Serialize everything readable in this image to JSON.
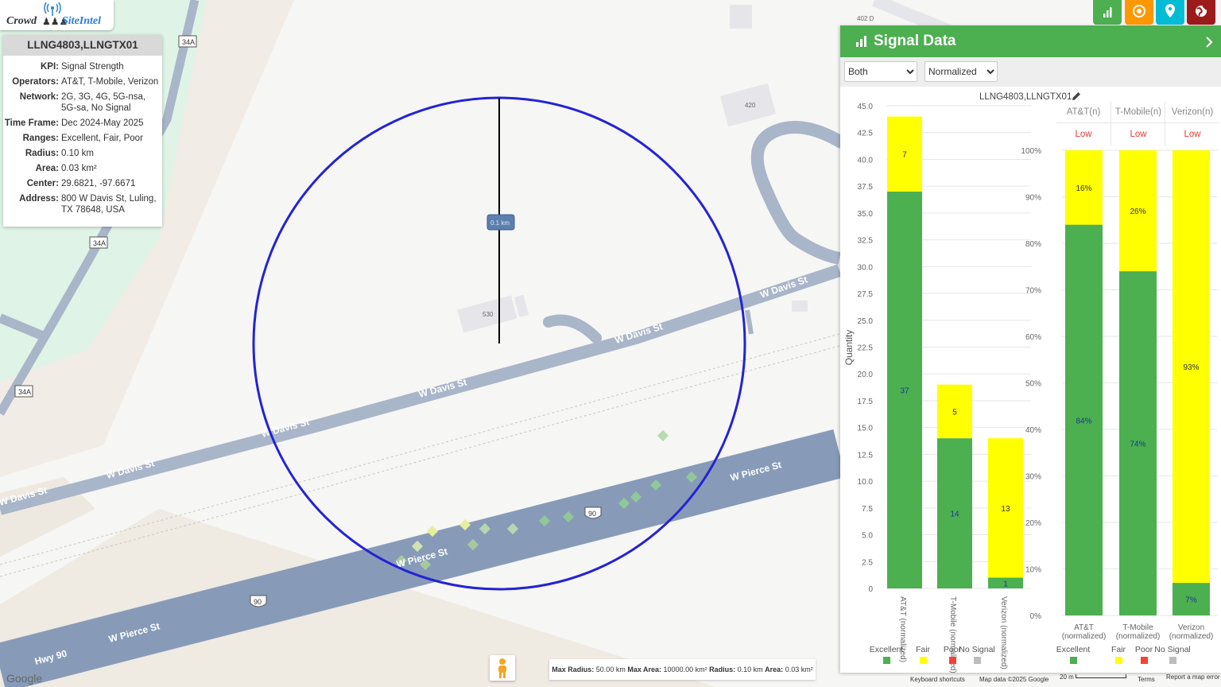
{
  "logo": {
    "part1": "Crowd",
    "part2": "SiteIntel"
  },
  "info": {
    "title": "LLNG4803,LLNGTX01",
    "rows": [
      {
        "k": "KPI:",
        "v": "Signal Strength"
      },
      {
        "k": "Operators:",
        "v": "AT&T, T-Mobile, Verizon"
      },
      {
        "k": "Network:",
        "v": "2G, 3G, 4G, 5G-nsa, 5G-sa, No Signal"
      },
      {
        "k": "Time Frame:",
        "v": "Dec 2024-May 2025"
      },
      {
        "k": "Ranges:",
        "v": "Excellent, Fair, Poor"
      },
      {
        "k": "Radius:",
        "v": "0.10 km"
      },
      {
        "k": "Area:",
        "v": "0.03 km²"
      },
      {
        "k": "Center:",
        "v": "29.6821, -97.6671"
      },
      {
        "k": "Address:",
        "v": "800 W Davis St, Luling, TX 78648, USA"
      }
    ]
  },
  "map": {
    "street_labels": [
      "W Davis St",
      "W Davis St",
      "W Davis St",
      "W Davis St",
      "W Davis St",
      "W Davis St",
      "W Pierce St",
      "W Pierce St",
      "W Pierce St",
      "Hwy 90"
    ],
    "route_shields": [
      "34A",
      "34A",
      "34A",
      "90",
      "90"
    ],
    "building_numbers": [
      "402 D",
      "420",
      "530"
    ],
    "radius_label": "0.1 km",
    "google": "Google",
    "footer": {
      "keyboard": "Keyboard shortcuts",
      "mapdata": "Map data ©2025 Google",
      "scale": "20 m",
      "terms": "Terms",
      "report": "Report a map error"
    }
  },
  "bottom_bar": {
    "max_radius_k": "Max Radius:",
    "max_radius_v": "50.00 km",
    "max_area_k": "Max Area:",
    "max_area_v": "10000.00 km²",
    "radius_k": "Radius:",
    "radius_v": "0.10 km",
    "area_k": "Area:",
    "area_v": "0.03 km²"
  },
  "toolbar_icons": [
    "bar-chart-icon",
    "target-icon",
    "map-pin-icon",
    "globe-icon"
  ],
  "colors": {
    "excellent": "#4caf50",
    "fair": "#ffff00",
    "poor": "#f44336",
    "no_signal": "#bdbdbd",
    "header": "#4caf50",
    "circle": "#2323d4",
    "low": "#e53935"
  },
  "signal_panel": {
    "title": "Signal Data",
    "select_mode": {
      "value": "Both",
      "options": [
        "Both"
      ]
    },
    "select_scale": {
      "value": "Normalized",
      "options": [
        "Normalized"
      ]
    },
    "site": "LLNG4803,LLNGTX01",
    "table_headers": [
      "AT&T(n)",
      "T-Mobile(n)",
      "Verizon(n)"
    ],
    "table_values": [
      "Low",
      "Low",
      "Low"
    ]
  },
  "chart_data": [
    {
      "type": "bar",
      "stacked": true,
      "ylabel": "Quantity",
      "ylim": [
        0,
        45
      ],
      "yticks": [
        "0",
        "2.5",
        "5.0",
        "7.5",
        "10.0",
        "12.5",
        "15.0",
        "17.5",
        "20.0",
        "22.5",
        "25.0",
        "27.5",
        "30.0",
        "32.5",
        "35.0",
        "37.5",
        "40.0",
        "42.5",
        "45.0"
      ],
      "categories": [
        "AT&T (normalized)",
        "T-Mobile (normalized)",
        "Verizon (normalized)"
      ],
      "series": [
        {
          "name": "Excellent",
          "values": [
            37,
            14,
            1
          ],
          "labels": [
            "37",
            "14",
            "1"
          ]
        },
        {
          "name": "Fair",
          "values": [
            7,
            5,
            13
          ],
          "labels": [
            "7",
            "5",
            "13"
          ]
        },
        {
          "name": "Poor",
          "values": [
            0,
            0,
            0
          ]
        },
        {
          "name": "No Signal",
          "values": [
            0,
            0,
            0
          ]
        }
      ],
      "legend": [
        "Excellent",
        "Fair",
        "Poor",
        "No Signal"
      ],
      "legend_position": "bottom"
    },
    {
      "type": "bar",
      "stacked": true,
      "ylim": [
        0,
        100
      ],
      "yticks": [
        "0%",
        "10%",
        "20%",
        "30%",
        "40%",
        "50%",
        "60%",
        "70%",
        "80%",
        "90%",
        "100%"
      ],
      "categories": [
        "AT&T (normalized)",
        "T-Mobile (normalized)",
        "Verizon (normalized)"
      ],
      "series": [
        {
          "name": "Excellent",
          "values": [
            84,
            74,
            7
          ],
          "labels": [
            "84%",
            "74%",
            "7%"
          ]
        },
        {
          "name": "Fair",
          "values": [
            16,
            26,
            93
          ],
          "labels": [
            "16%",
            "26%",
            "93%"
          ]
        },
        {
          "name": "Poor",
          "values": [
            0,
            0,
            0
          ]
        },
        {
          "name": "No Signal",
          "values": [
            0,
            0,
            0
          ]
        }
      ],
      "legend": [
        "Excellent",
        "Fair",
        "Poor",
        "No Signal"
      ],
      "legend_position": "bottom"
    }
  ]
}
